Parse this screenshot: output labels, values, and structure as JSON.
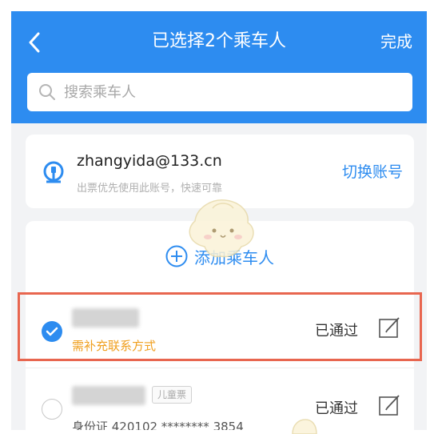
{
  "header": {
    "title": "已选择2个乘车人",
    "done_label": "完成",
    "back_icon": "chevron-left-icon",
    "background_color": "#2d8cf0"
  },
  "search": {
    "placeholder": "搜索乘车人",
    "value": "",
    "icon": "search-icon"
  },
  "account": {
    "email": "zhangyida@133.cn",
    "hint": "出票优先使用此账号，快速可靠",
    "switch_label": "切换账号",
    "icon": "railway-logo-icon"
  },
  "add_passenger": {
    "label": "添加乘车人",
    "icon": "plus-circle-icon"
  },
  "passengers": [
    {
      "selected": true,
      "sub_text": "需补充联系方式",
      "status": "已通过",
      "tag": ""
    },
    {
      "selected": false,
      "sub_text": "身份证 420102 ******** 3854",
      "status": "已通过",
      "tag": "儿童票"
    }
  ],
  "colors": {
    "accent": "#2d8cf0",
    "warning": "#f0a020",
    "highlight_box": "#e8664f"
  }
}
